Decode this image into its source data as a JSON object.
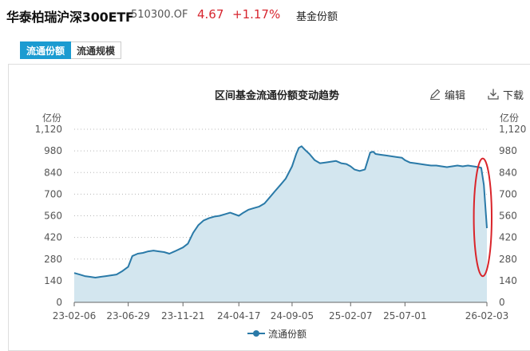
{
  "header": {
    "fund_name": "华泰柏瑞沪深300ETF",
    "fund_code": "510300.OF",
    "price": "4.67",
    "change": "+1.17%",
    "section": "基金份额",
    "up_color": "#d7262f"
  },
  "tabs": [
    {
      "label": "流通份额",
      "active": true
    },
    {
      "label": "流通规模",
      "active": false
    }
  ],
  "toolbar": {
    "edit_label": "编辑",
    "download_label": "下载"
  },
  "chart_data": {
    "type": "area",
    "title": "区间基金流通份额变动趋势",
    "ylabel_left": "亿份",
    "ylabel_right": "亿份",
    "ylim": [
      0,
      1120
    ],
    "yticks": [
      0,
      140,
      280,
      420,
      560,
      700,
      840,
      980,
      1120
    ],
    "ytick_labels": [
      "0",
      "140",
      "280",
      "420",
      "560",
      "700",
      "840",
      "980",
      "1,120"
    ],
    "grid": true,
    "xtick_labels": [
      "23-02-06",
      "23-06-29",
      "23-11-21",
      "24-04-17",
      "24-09-05",
      "25-02-07",
      "25-07-01",
      "26-02-03"
    ],
    "legend": "bottom",
    "series": [
      {
        "name": "流通份额",
        "color": "#2a7aa8",
        "fill": "#d3e6ef",
        "x": [
          "23-02-06",
          "23-02-20",
          "23-03-06",
          "23-03-20",
          "23-04-03",
          "23-04-17",
          "23-05-01",
          "23-05-15",
          "23-05-29",
          "23-06-12",
          "23-06-29",
          "23-07-10",
          "23-07-24",
          "23-08-07",
          "23-08-21",
          "23-09-04",
          "23-09-18",
          "23-10-02",
          "23-10-16",
          "23-10-30",
          "23-11-21",
          "23-12-04",
          "23-12-18",
          "24-01-01",
          "24-01-15",
          "24-01-29",
          "24-02-12",
          "24-02-26",
          "24-03-11",
          "24-03-25",
          "24-04-17",
          "24-04-29",
          "24-05-13",
          "24-05-27",
          "24-06-10",
          "24-06-24",
          "24-07-08",
          "24-07-22",
          "24-08-05",
          "24-08-19",
          "24-09-05",
          "24-09-16",
          "24-09-23",
          "24-09-30",
          "24-10-08",
          "24-10-21",
          "24-11-04",
          "24-11-18",
          "24-12-02",
          "24-12-16",
          "24-12-30",
          "25-01-13",
          "25-01-27",
          "25-02-07",
          "25-02-17",
          "25-03-03",
          "25-03-17",
          "25-03-31",
          "25-04-08",
          "25-04-14",
          "25-04-28",
          "25-05-12",
          "25-05-26",
          "25-06-09",
          "25-06-23",
          "25-07-01",
          "25-07-14",
          "25-07-28",
          "25-08-11",
          "25-08-25",
          "25-09-08",
          "25-09-22",
          "25-10-06",
          "25-10-20",
          "25-11-03",
          "25-11-17",
          "25-12-01",
          "25-12-15",
          "25-12-29",
          "26-01-12",
          "26-01-19",
          "26-01-26",
          "26-02-03"
        ],
        "values": [
          190,
          180,
          170,
          165,
          160,
          165,
          170,
          175,
          180,
          200,
          230,
          300,
          315,
          320,
          330,
          335,
          330,
          325,
          315,
          330,
          355,
          380,
          450,
          500,
          530,
          545,
          555,
          560,
          570,
          580,
          560,
          580,
          600,
          610,
          620,
          640,
          680,
          720,
          760,
          800,
          880,
          960,
          1000,
          1010,
          990,
          960,
          920,
          900,
          905,
          910,
          915,
          900,
          895,
          880,
          860,
          850,
          860,
          970,
          975,
          960,
          955,
          950,
          945,
          940,
          935,
          920,
          905,
          900,
          895,
          890,
          885,
          885,
          880,
          875,
          880,
          885,
          880,
          885,
          880,
          875,
          870,
          760,
          480
        ]
      }
    ],
    "annotation": {
      "type": "ellipse",
      "color": "#d9242a",
      "range_from": "26-01-12",
      "range_to": "26-02-03"
    }
  }
}
